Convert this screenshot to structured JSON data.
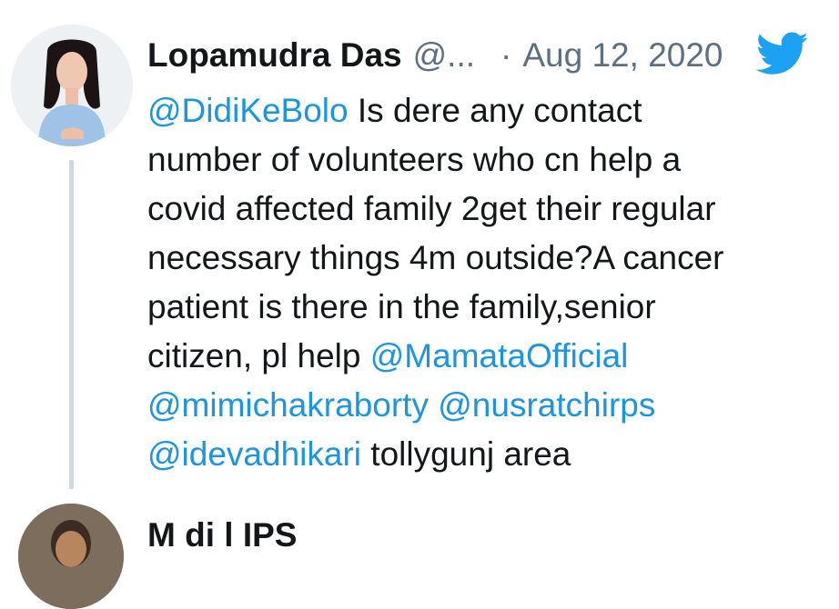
{
  "tweet": {
    "author_name": "Lopamudra Das",
    "author_handle": "@...",
    "separator": "·",
    "date": "Aug 12, 2020",
    "lines": [
      [
        {
          "text": "@DidiKeBolo",
          "type": "mention"
        },
        {
          "text": " Is dere any contact",
          "type": "text"
        }
      ],
      [
        {
          "text": "number of volunteers who cn help a",
          "type": "text"
        }
      ],
      [
        {
          "text": "covid affected family 2get their regular",
          "type": "text"
        }
      ],
      [
        {
          "text": "necessary things 4m outside?A cancer",
          "type": "text"
        }
      ],
      [
        {
          "text": "patient is there in the family,senior",
          "type": "text"
        }
      ],
      [
        {
          "text": "citizen, pl help ",
          "type": "text"
        },
        {
          "text": "@MamataOfficial",
          "type": "mention"
        }
      ],
      [
        {
          "text": "@mimichakraborty",
          "type": "mention"
        },
        {
          "text": " ",
          "type": "text"
        },
        {
          "text": "@nusratchirps",
          "type": "mention"
        }
      ],
      [
        {
          "text": "@idevadhikari",
          "type": "mention"
        },
        {
          "text": " tollygunj area",
          "type": "text"
        }
      ]
    ]
  },
  "next_tweet": {
    "author_name_partial": "M di l  IPS"
  },
  "icons": {
    "brand": "twitter-bird-icon"
  },
  "colors": {
    "mention": "#1b95e0",
    "brand": "#1da1f2",
    "secondary_text": "#5b7083",
    "thread_line": "#cfd9de"
  }
}
